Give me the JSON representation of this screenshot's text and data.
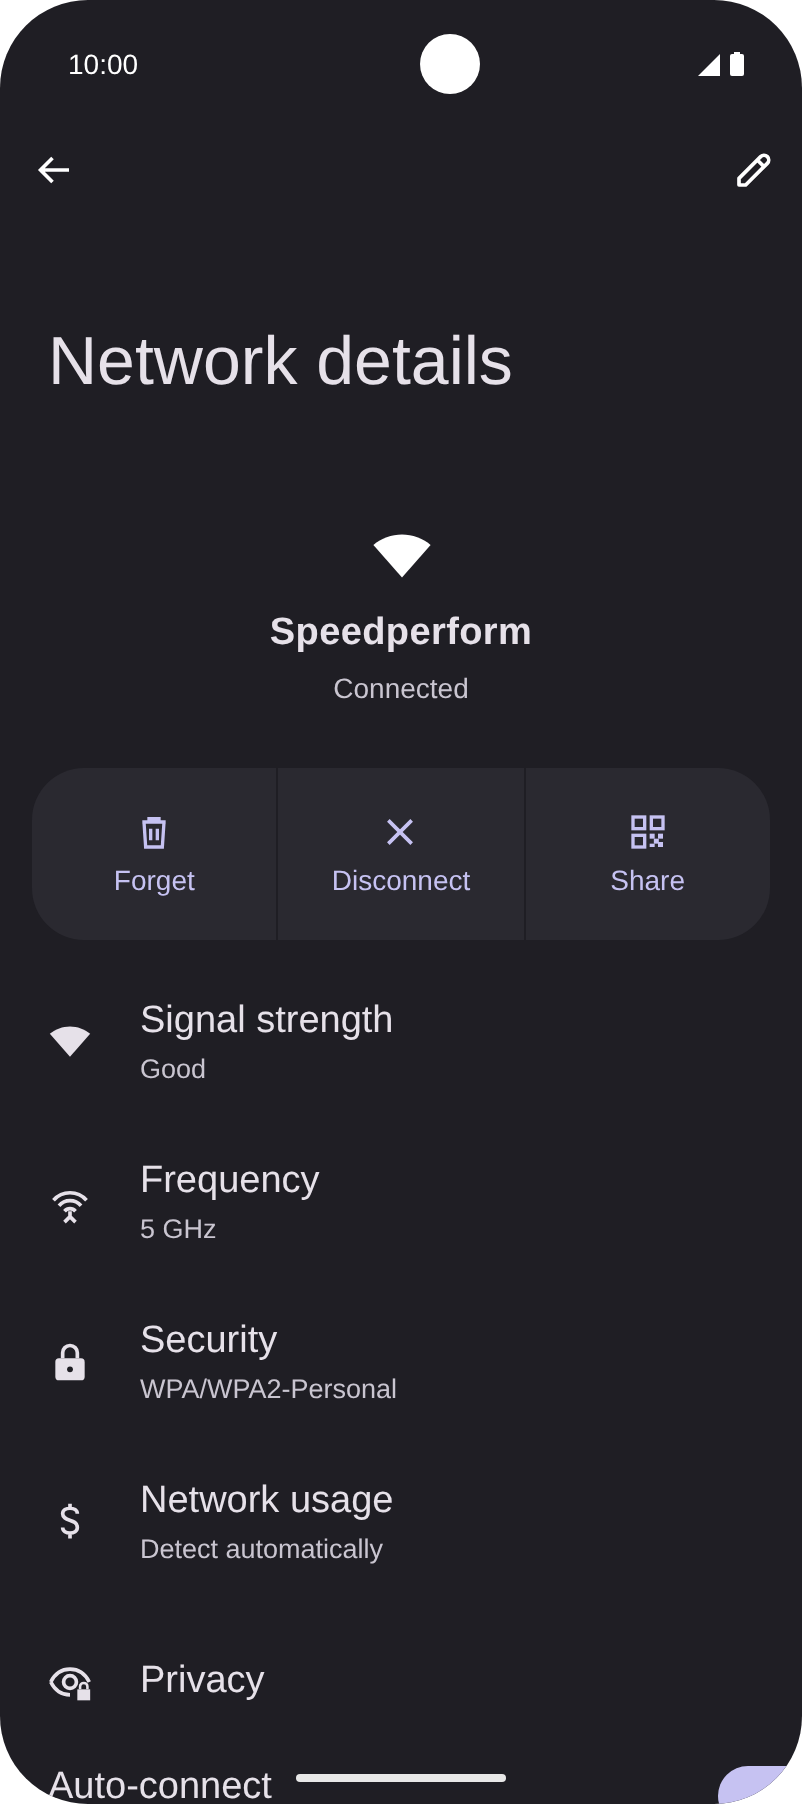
{
  "status_bar": {
    "time": "10:00"
  },
  "title": "Network details",
  "network": {
    "name": "Speedperform",
    "status": "Connected"
  },
  "actions": [
    {
      "label": "Forget"
    },
    {
      "label": "Disconnect"
    },
    {
      "label": "Share"
    }
  ],
  "details": [
    {
      "title": "Signal strength",
      "subtitle": "Good"
    },
    {
      "title": "Frequency",
      "subtitle": "5 GHz"
    },
    {
      "title": "Security",
      "subtitle": "WPA/WPA2-Personal"
    },
    {
      "title": "Network usage",
      "subtitle": "Detect automatically"
    },
    {
      "title": "Privacy"
    }
  ],
  "auto_connect": {
    "label": "Auto-connect",
    "on": true
  }
}
